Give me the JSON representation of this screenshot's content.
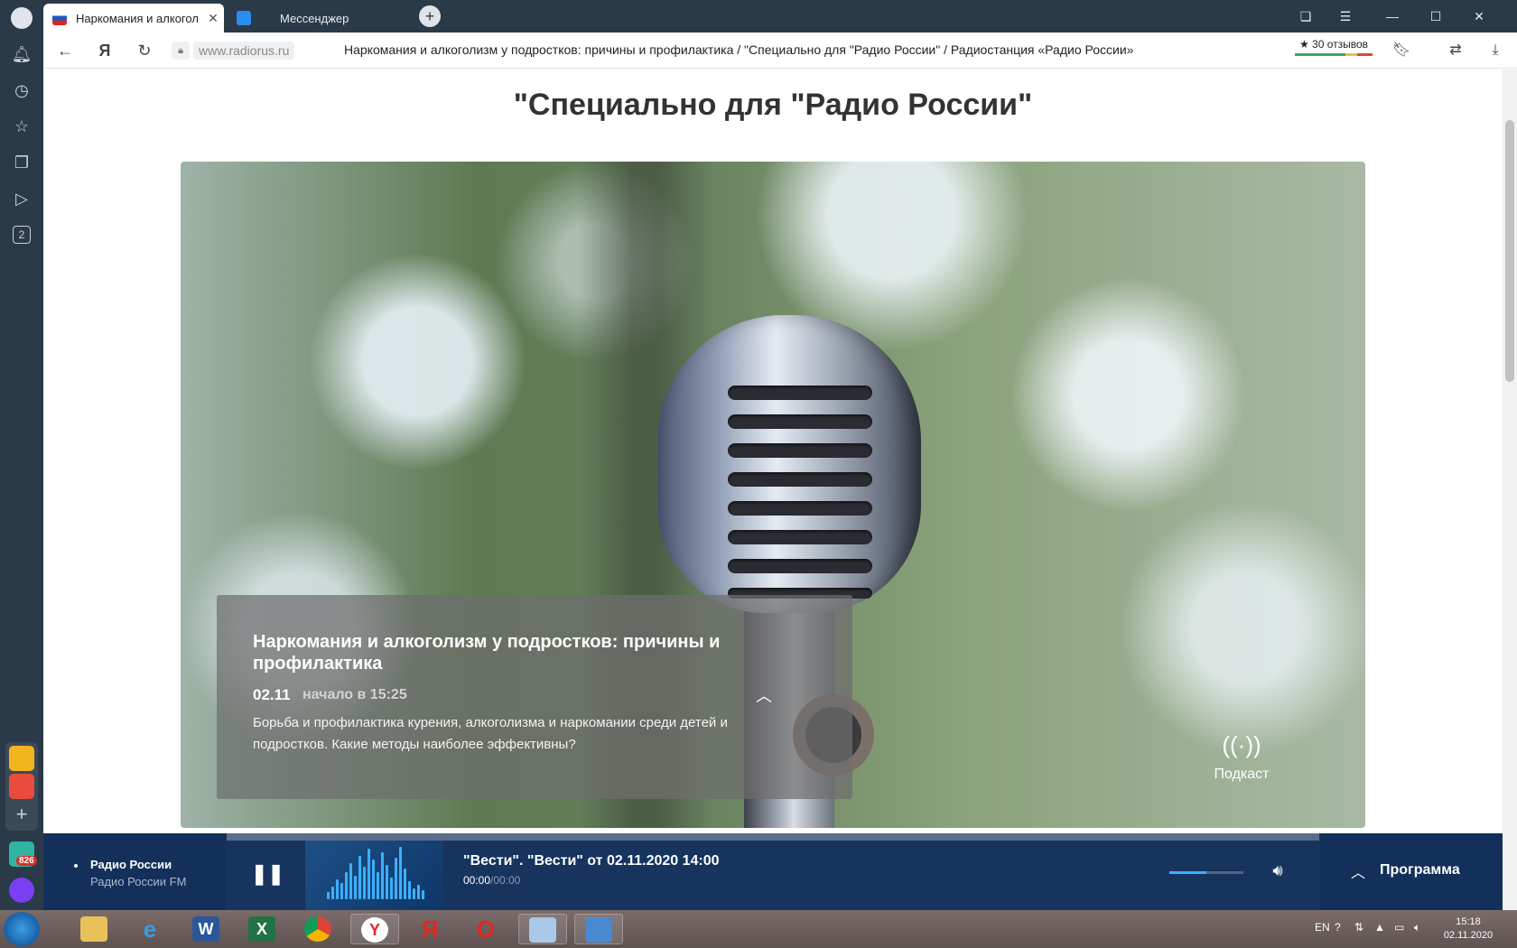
{
  "browser": {
    "tabs": [
      {
        "label": "Наркомания и алкогол",
        "active": true
      },
      {
        "label": "Мессенджер",
        "active": false
      }
    ],
    "url": "www.radiorus.ru",
    "page_title": "Наркомания и алкоголизм у подростков: причины и профилактика / \"Специально для \"Радио России\" / Радиостанция «Радио России»",
    "reviews": "★ 30 отзывов",
    "sidebar_counter": "2",
    "mail_badge": "826"
  },
  "page": {
    "section_title": "\"Специально для \"Радио России\"",
    "episode": {
      "title": "Наркомания и алкоголизм у подростков: причины и профилактика",
      "date": "02.11",
      "start": "начало в 15:25",
      "description": "Борьба и профилактика курения, алкоголизма и наркомании среди детей и подростков. Какие методы наиболее эффективны?"
    },
    "podcast_label": "Подкаст"
  },
  "player": {
    "station_name": "Радио России",
    "station_sub": "Радио России FM",
    "track_title": "\"Вести\". \"Вести\" от 02.11.2020 14:00",
    "time_current": "00:00",
    "time_total": "/00:00",
    "volume_level": 0.5,
    "program_label": "Программа"
  },
  "taskbar": {
    "language": "EN",
    "time": "15:18",
    "date": "02.11.2020"
  },
  "colors": {
    "sidebar_bg": "#2b3a48",
    "player_bg": "#16345e",
    "accent_blue": "#3ab0ff"
  }
}
